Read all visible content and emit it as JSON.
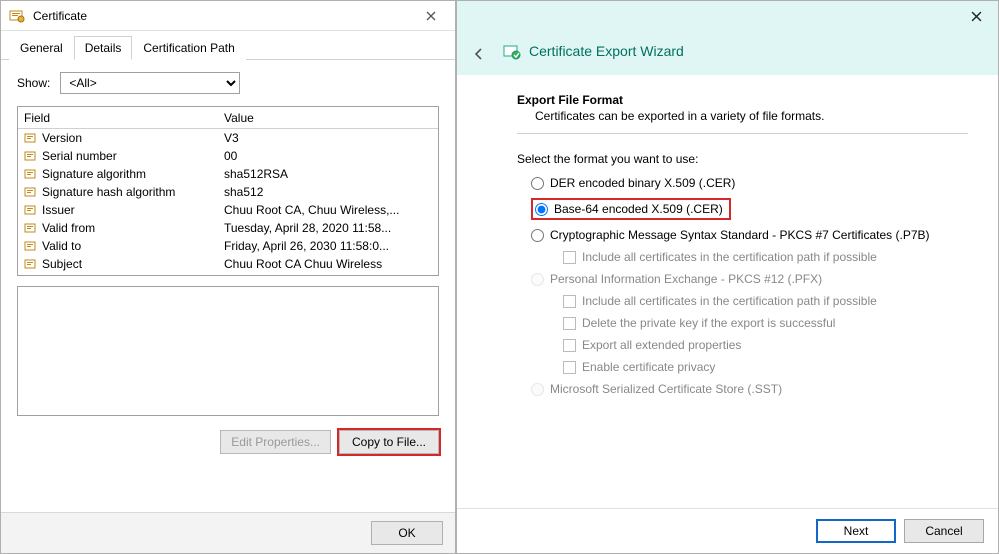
{
  "cert_dialog": {
    "title": "Certificate",
    "tabs": {
      "general": "General",
      "details": "Details",
      "certpath": "Certification Path"
    },
    "show_label": "Show:",
    "show_selected": "<All>",
    "columns": {
      "field": "Field",
      "value": "Value"
    },
    "rows": [
      {
        "field": "Version",
        "value": "V3"
      },
      {
        "field": "Serial number",
        "value": "00"
      },
      {
        "field": "Signature algorithm",
        "value": "sha512RSA"
      },
      {
        "field": "Signature hash algorithm",
        "value": "sha512"
      },
      {
        "field": "Issuer",
        "value": "Chuu Root CA, Chuu Wireless,..."
      },
      {
        "field": "Valid from",
        "value": "Tuesday, April 28, 2020 11:58..."
      },
      {
        "field": "Valid to",
        "value": "Friday, April 26, 2030 11:58:0..."
      },
      {
        "field": "Subject",
        "value": "Chuu Root CA  Chuu Wireless"
      }
    ],
    "edit_btn": "Edit Properties...",
    "copy_btn": "Copy to File...",
    "ok_btn": "OK"
  },
  "wizard": {
    "title": "Certificate Export Wizard",
    "heading": "Export File Format",
    "sub": "Certificates can be exported in a variety of file formats.",
    "select_label": "Select the format you want to use:",
    "opts": {
      "der": "DER encoded binary X.509 (.CER)",
      "b64": "Base-64 encoded X.509 (.CER)",
      "pkcs7": "Cryptographic Message Syntax Standard - PKCS #7 Certificates (.P7B)",
      "pkcs7_sub": "Include all certificates in the certification path if possible",
      "pfx": "Personal Information Exchange - PKCS #12 (.PFX)",
      "pfx_sub1": "Include all certificates in the certification path if possible",
      "pfx_sub2": "Delete the private key if the export is successful",
      "pfx_sub3": "Export all extended properties",
      "pfx_sub4": "Enable certificate privacy",
      "sst": "Microsoft Serialized Certificate Store (.SST)"
    },
    "next_btn": "Next",
    "cancel_btn": "Cancel"
  }
}
